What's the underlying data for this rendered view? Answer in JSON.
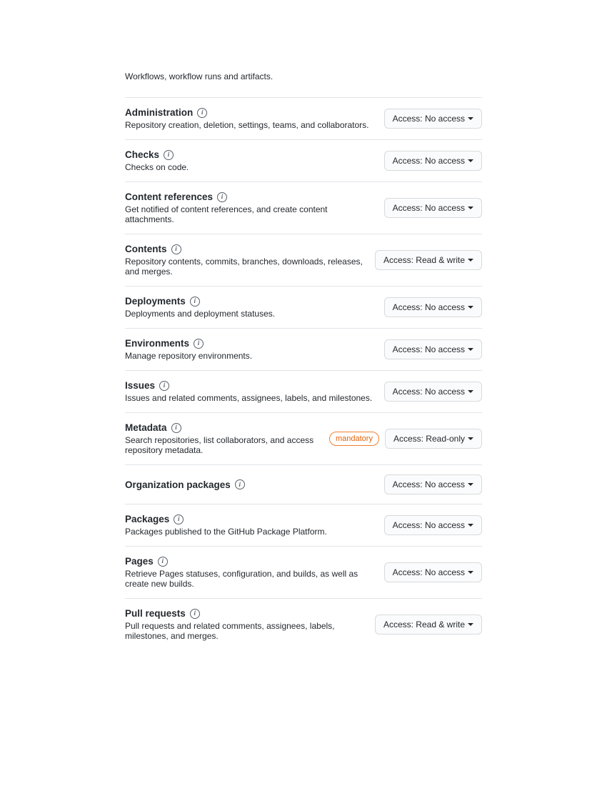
{
  "intro_text": "Workflows, workflow runs and artifacts.",
  "access_prefix": "Access: ",
  "permissions": [
    {
      "title": "Administration",
      "desc": "Repository creation, deletion, settings, teams, and collaborators.",
      "access": "No access",
      "badge": null
    },
    {
      "title": "Checks",
      "desc": "Checks on code.",
      "access": "No access",
      "badge": null
    },
    {
      "title": "Content references",
      "desc": "Get notified of content references, and create content attachments.",
      "access": "No access",
      "badge": null
    },
    {
      "title": "Contents",
      "desc": "Repository contents, commits, branches, downloads, releases, and merges.",
      "access": "Read & write",
      "badge": null
    },
    {
      "title": "Deployments",
      "desc": "Deployments and deployment statuses.",
      "access": "No access",
      "badge": null
    },
    {
      "title": "Environments",
      "desc": "Manage repository environments.",
      "access": "No access",
      "badge": null
    },
    {
      "title": "Issues",
      "desc": "Issues and related comments, assignees, labels, and milestones.",
      "access": "No access",
      "badge": null
    },
    {
      "title": "Metadata",
      "desc": "Search repositories, list collaborators, and access repository metadata.",
      "access": "Read-only",
      "badge": "mandatory"
    },
    {
      "title": "Organization packages",
      "desc": "",
      "access": "No access",
      "badge": null
    },
    {
      "title": "Packages",
      "desc": "Packages published to the GitHub Package Platform.",
      "access": "No access",
      "badge": null
    },
    {
      "title": "Pages",
      "desc": "Retrieve Pages statuses, configuration, and builds, as well as create new builds.",
      "access": "No access",
      "badge": null
    },
    {
      "title": "Pull requests",
      "desc": "Pull requests and related comments, assignees, labels, milestones, and merges.",
      "access": "Read & write",
      "badge": null
    }
  ]
}
